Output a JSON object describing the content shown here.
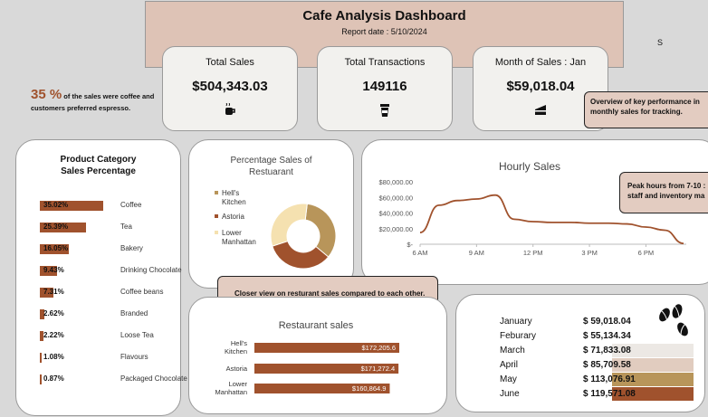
{
  "header": {
    "title": "Cafe Analysis Dashboard",
    "report_date": "Report date : 5/10/2024",
    "corner_letter": "S"
  },
  "kpis": [
    {
      "label": "Total Sales",
      "value": "$504,343.03",
      "icon": "coffee-cup-icon"
    },
    {
      "label": "Total Transactions",
      "value": "149116",
      "icon": "takeaway-cup-icon"
    },
    {
      "label": "Month of Sales : Jan",
      "value": "$59,018.04",
      "icon": "cake-slice-icon"
    }
  ],
  "insight": {
    "percent": "35 %",
    "text": "of the sales were coffee and customers preferred espresso."
  },
  "notes": {
    "overview": "Overview of key performance in monthly sales for tracking.",
    "peak": "Peak hours from 7-10 : staff and inventory ma",
    "closer": "Closer view on resturant sales compared to each other."
  },
  "category_panel": {
    "title": "Product Category Sales Percentage",
    "items": [
      {
        "label": "Coffee",
        "pct": "35.02%",
        "value": 35.02
      },
      {
        "label": "Tea",
        "pct": "25.39%",
        "value": 25.39
      },
      {
        "label": "Bakery",
        "pct": "16.05%",
        "value": 16.05
      },
      {
        "label": "Drinking Chocolate",
        "pct": "9.43%",
        "value": 9.43
      },
      {
        "label": "Coffee beans",
        "pct": "7.31%",
        "value": 7.31
      },
      {
        "label": "Branded",
        "pct": "2.62%",
        "value": 2.62
      },
      {
        "label": "Loose Tea",
        "pct": "2.22%",
        "value": 2.22
      },
      {
        "label": "Flavours",
        "pct": "1.08%",
        "value": 1.08
      },
      {
        "label": "Packaged Chocolate",
        "pct": "0.87%",
        "value": 0.87
      }
    ]
  },
  "donut_panel": {
    "title": "Percentage Sales of Restuarant",
    "legend": [
      "Hell's Kitchen",
      "Astoria",
      "Lower Manhattan"
    ],
    "colors": [
      "#b8955a",
      "#a0522d",
      "#f5e1b0"
    ]
  },
  "hourly_panel": {
    "title": "Hourly Sales"
  },
  "restaurant_panel": {
    "title": "Restaurant sales"
  },
  "months": {
    "items": [
      {
        "name": "January",
        "value": "$ 59,018.04",
        "swatch": ""
      },
      {
        "name": "Feburary",
        "value": "$ 55,134.34",
        "swatch": ""
      },
      {
        "name": "March",
        "value": "$ 71,833.08",
        "swatch": "#ece8e4"
      },
      {
        "name": "April",
        "value": "$ 85,709.58",
        "swatch": "#e1ccbf"
      },
      {
        "name": "May",
        "value": "$ 113,076.91",
        "swatch": "#b8955a"
      },
      {
        "name": "June",
        "value": "$ 119,571.08",
        "swatch": "#a0522d"
      }
    ]
  },
  "chart_data": [
    {
      "type": "pie",
      "title": "Percentage Sales of Restuarant",
      "categories": [
        "Hell's Kitchen",
        "Astoria",
        "Lower Manhattan"
      ],
      "values": [
        172205.6,
        171272.4,
        160864.9
      ],
      "colors": [
        "#b8955a",
        "#a0522d",
        "#f5e1b0"
      ],
      "legend": "left"
    },
    {
      "type": "line",
      "title": "Hourly Sales",
      "x": [
        6,
        7,
        8,
        9,
        10,
        11,
        12,
        13,
        14,
        15,
        16,
        17,
        18,
        19,
        20
      ],
      "y": [
        15000,
        50000,
        56000,
        58000,
        63000,
        32000,
        29000,
        28000,
        28000,
        27000,
        27000,
        26000,
        22000,
        18000,
        1000
      ],
      "xticks": [
        "6 AM",
        "9 AM",
        "12 PM",
        "3 PM",
        "6 PM"
      ],
      "xtick_values": [
        6,
        9,
        12,
        15,
        18
      ],
      "yticks": [
        "$-",
        "$20,000.00",
        "$40,000.00",
        "$60,000.00",
        "$80,000.00"
      ],
      "ytick_values": [
        0,
        20000,
        40000,
        60000,
        80000
      ],
      "ylim": [
        0,
        80000
      ],
      "color": "#a0522d"
    },
    {
      "type": "bar",
      "orientation": "horizontal",
      "title": "Restaurant sales",
      "categories": [
        "Hell's Kitchen",
        "Astoria",
        "Lower Manhattan"
      ],
      "values": [
        172205.6,
        171272.4,
        160864.9
      ],
      "labels": [
        "$172,205.6",
        "$171,272.4",
        "$160,864.9"
      ],
      "color": "#a0522d"
    }
  ]
}
